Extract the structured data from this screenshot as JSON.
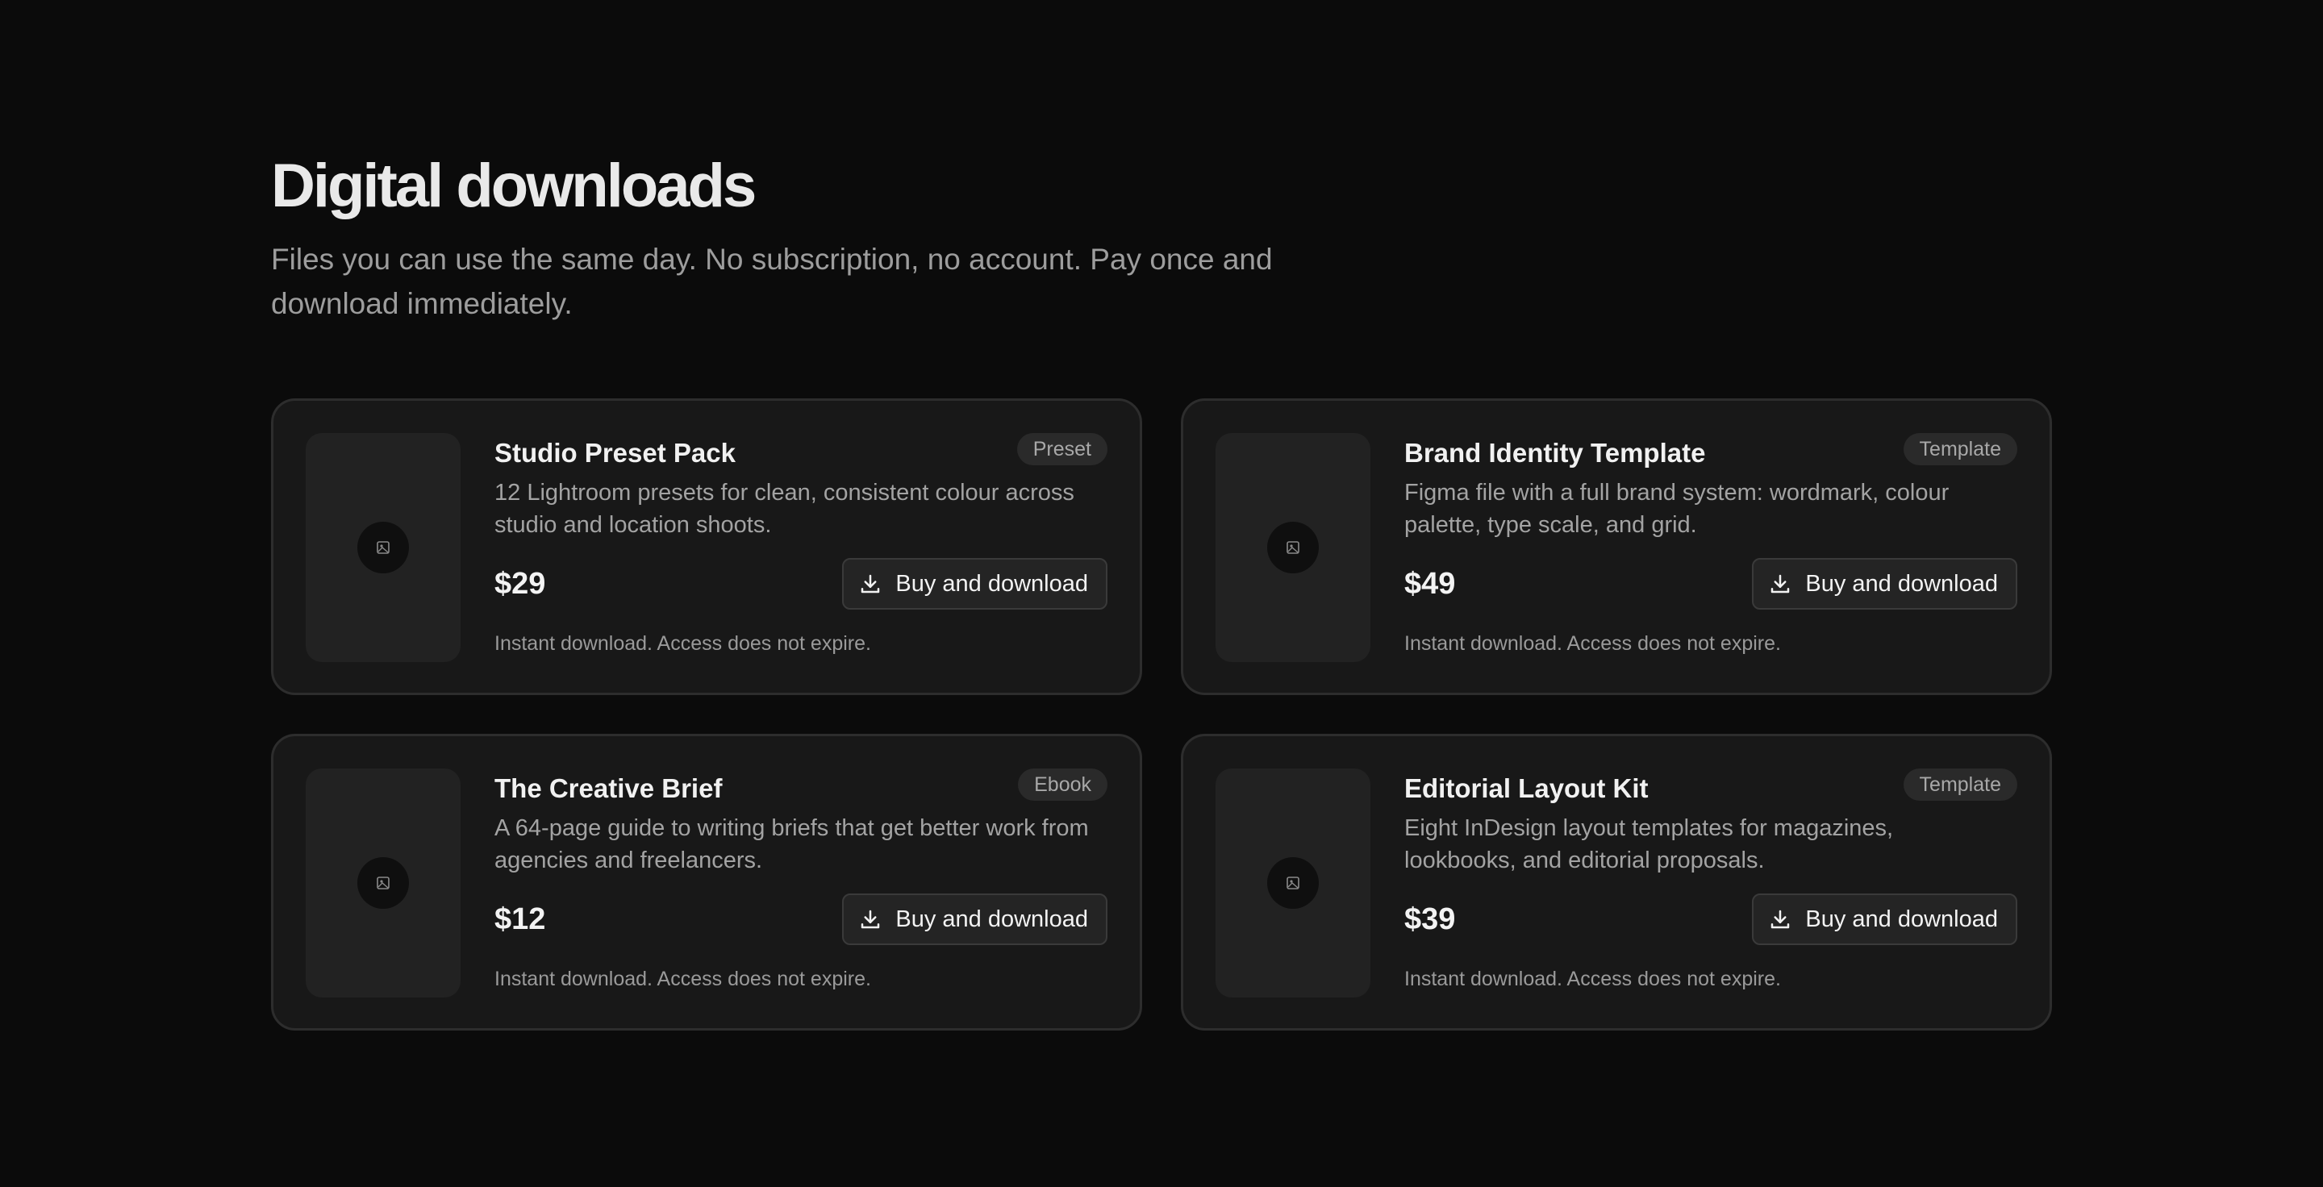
{
  "header": {
    "title": "Digital downloads",
    "subtitle": "Files you can use the same day. No subscription, no account. Pay once and download immediately."
  },
  "colors": {
    "background": "#0b0b0b",
    "card_background": "#181818",
    "card_border": "#2d2d2d",
    "badge_background": "#2a2a2a",
    "text_primary": "#f1f1f1",
    "text_muted": "#a3a3a3"
  },
  "products": [
    {
      "title": "Studio Preset Pack",
      "badge": "Preset",
      "description": "12 Lightroom presets for clean, consistent colour across studio and location shoots.",
      "price": "$29",
      "button_label": "Buy and download",
      "button_icon": "download-icon",
      "thumbnail_icon": "image-placeholder-icon",
      "note": "Instant download. Access does not expire."
    },
    {
      "title": "Brand Identity Template",
      "badge": "Template",
      "description": "Figma file with a full brand system: wordmark, colour palette, type scale, and grid.",
      "price": "$49",
      "button_label": "Buy and download",
      "button_icon": "download-icon",
      "thumbnail_icon": "image-placeholder-icon",
      "note": "Instant download. Access does not expire."
    },
    {
      "title": "The Creative Brief",
      "badge": "Ebook",
      "description": "A 64-page guide to writing briefs that get better work from agencies and freelancers.",
      "price": "$12",
      "button_label": "Buy and download",
      "button_icon": "download-icon",
      "thumbnail_icon": "image-placeholder-icon",
      "note": "Instant download. Access does not expire."
    },
    {
      "title": "Editorial Layout Kit",
      "badge": "Template",
      "description": "Eight InDesign layout templates for magazines, lookbooks, and editorial proposals.",
      "price": "$39",
      "button_label": "Buy and download",
      "button_icon": "download-icon",
      "thumbnail_icon": "image-placeholder-icon",
      "note": "Instant download. Access does not expire."
    }
  ]
}
